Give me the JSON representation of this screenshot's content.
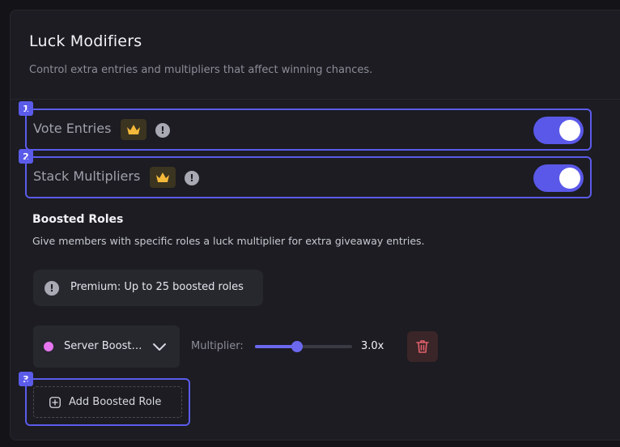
{
  "header": {
    "title": "Luck Modifiers",
    "subtitle": "Control extra entries and multipliers that affect winning chances."
  },
  "settings": [
    {
      "badge": "1",
      "label": "Vote Entries",
      "premium_icon": "crown-icon",
      "info_icon": "info-icon",
      "enabled": true
    },
    {
      "badge": "2",
      "label": "Stack Multipliers",
      "premium_icon": "crown-icon",
      "info_icon": "info-icon",
      "enabled": true
    }
  ],
  "boosted_roles": {
    "title": "Boosted Roles",
    "description": "Give members with specific roles a luck multiplier for extra giveaway entries.",
    "premium_notice": "Premium: Up to 25 boosted roles",
    "role": {
      "name": "Server Boost…",
      "color": "#e576f0",
      "multiplier_label": "Multiplier:",
      "multiplier_value": "3.0x",
      "slider_fraction": 0.43
    },
    "add_badge": "3",
    "add_label": "Add Boosted Role"
  },
  "colors": {
    "accent": "#5b5bea",
    "toggle_on": "#5a58e8",
    "crown": "#f5b93a",
    "danger": "#e0606a"
  }
}
